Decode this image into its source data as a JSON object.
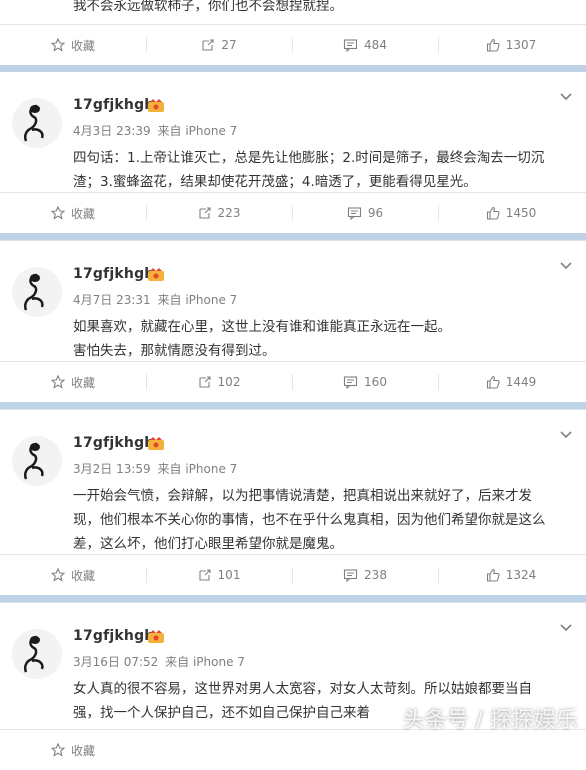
{
  "top_partial": {
    "text": "我不会永远做软柿子，你们也不会想捏就捏。",
    "actions": {
      "favorite": "收藏",
      "repost": "27",
      "comment": "484",
      "like": "1307"
    }
  },
  "posts": [
    {
      "username": "17gfjkhgh",
      "date": "4月3日 23:39",
      "source": "来自 iPhone 7",
      "body": [
        "四句话：1.上帝让谁灭亡，总是先让他膨胀；2.时间是筛子，最终会淘去一切沉",
        "渣；3.蜜蜂盗花，结果却使花开茂盛；4.暗透了，更能看得见星光。"
      ],
      "actions": {
        "favorite": "收藏",
        "repost": "223",
        "comment": "96",
        "like": "1450"
      }
    },
    {
      "username": "17gfjkhgh",
      "date": "4月7日 23:31",
      "source": "来自 iPhone 7",
      "body": [
        "如果喜欢，就藏在心里，这世上没有谁和谁能真正永远在一起。",
        "害怕失去，那就情愿没有得到过。"
      ],
      "actions": {
        "favorite": "收藏",
        "repost": "102",
        "comment": "160",
        "like": "1449"
      }
    },
    {
      "username": "17gfjkhgh",
      "date": "3月2日 13:59",
      "source": "来自 iPhone 7",
      "body": [
        "一开始会气愤，会辩解，以为把事情说清楚，把真相说出来就好了，后来才发",
        "现，他们根本不关心你的事情，也不在乎什么鬼真相，因为他们希望你就是这么",
        "差，这么坏，他们打心眼里希望你就是魔鬼。"
      ],
      "actions": {
        "favorite": "收藏",
        "repost": "101",
        "comment": "238",
        "like": "1324"
      }
    },
    {
      "username": "17gfjkhgh",
      "date": "3月16日 07:52",
      "source": "来自 iPhone 7",
      "body": [
        "女人真的很不容易，这世界对男人太宽容，对女人太苛刻。所以姑娘都要当自",
        "强，找一个人保护自己，还不如自己保护自己来着"
      ],
      "actions": {
        "favorite": "收藏",
        "repost": "",
        "comment": "",
        "like": ""
      }
    }
  ],
  "watermark": "头条号 / 探探娱乐"
}
